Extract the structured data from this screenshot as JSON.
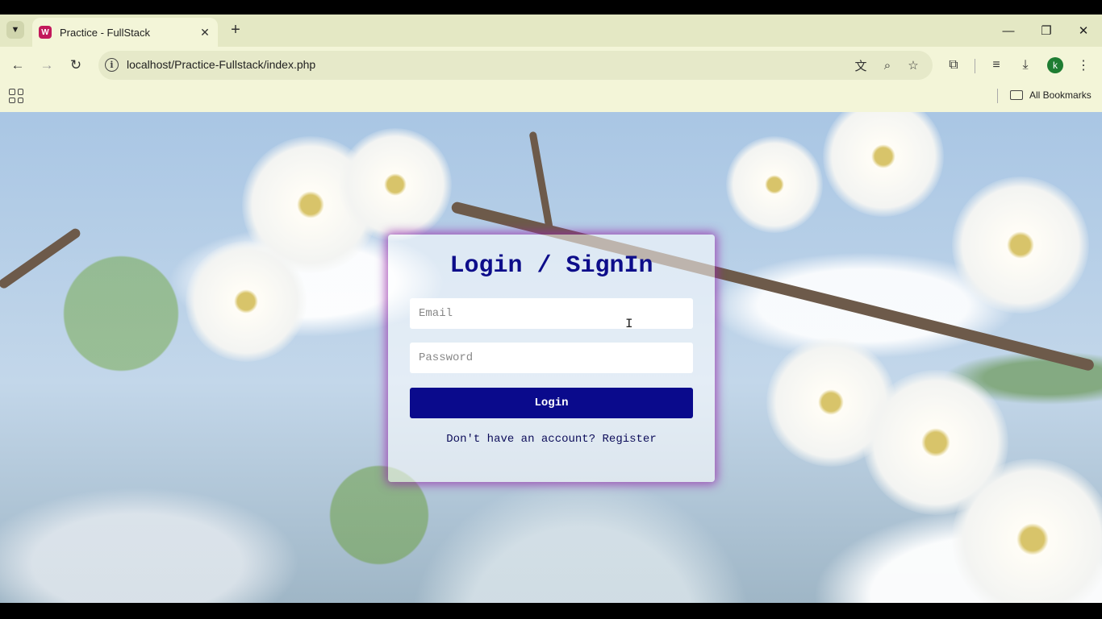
{
  "browser": {
    "tab": {
      "favicon": "W",
      "title": "Practice - FullStack",
      "close_icon": "close-icon"
    },
    "new_tab_label": "+",
    "url": "localhost/Practice-Fullstack/index.php",
    "profile_initial": "k",
    "bookmarks_label": "All Bookmarks",
    "accent_color": "#f3f5d8"
  },
  "login": {
    "title": "Login / SignIn",
    "email_placeholder": "Email",
    "password_placeholder": "Password",
    "submit_label": "Login",
    "register_prompt": "Don't have an account?",
    "register_link": "Register",
    "button_color": "#0a0a8c",
    "title_color": "#0d0d8a"
  }
}
